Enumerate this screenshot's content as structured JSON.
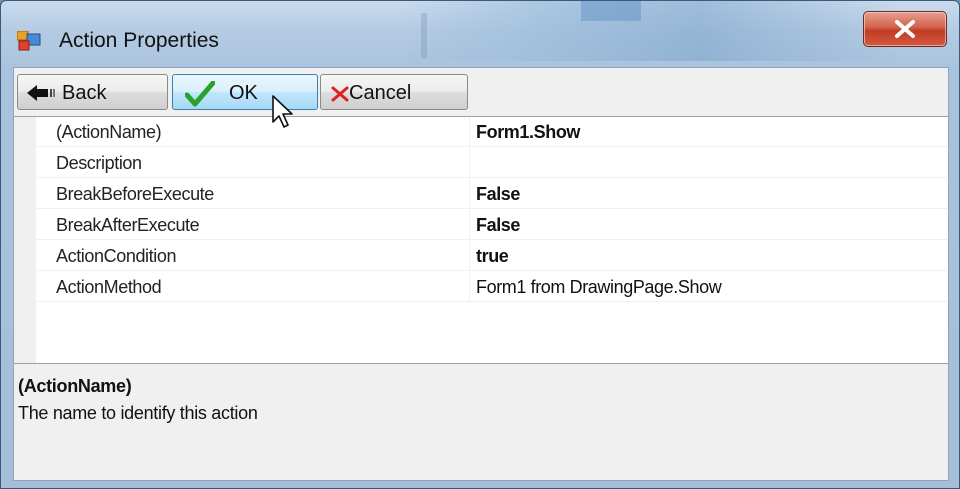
{
  "window": {
    "title": "Action Properties",
    "close_icon": "close-x-icon"
  },
  "toolbar": {
    "back_label": "Back",
    "ok_label": "OK",
    "cancel_label": "Cancel"
  },
  "properties": [
    {
      "name": "(ActionName)",
      "value": "Form1.Show",
      "bold": true
    },
    {
      "name": "Description",
      "value": "",
      "bold": false
    },
    {
      "name": "BreakBeforeExecute",
      "value": "False",
      "bold": true
    },
    {
      "name": "BreakAfterExecute",
      "value": "False",
      "bold": true
    },
    {
      "name": "ActionCondition",
      "value": "true",
      "bold": true
    },
    {
      "name": "ActionMethod",
      "value": "Form1 from DrawingPage.Show",
      "bold": false
    }
  ],
  "description_panel": {
    "title": "(ActionName)",
    "text": "The name to identify this action"
  },
  "colors": {
    "ok_check": "#2ca02c",
    "cancel_x": "#e02020",
    "close_button": "#c13b24"
  }
}
